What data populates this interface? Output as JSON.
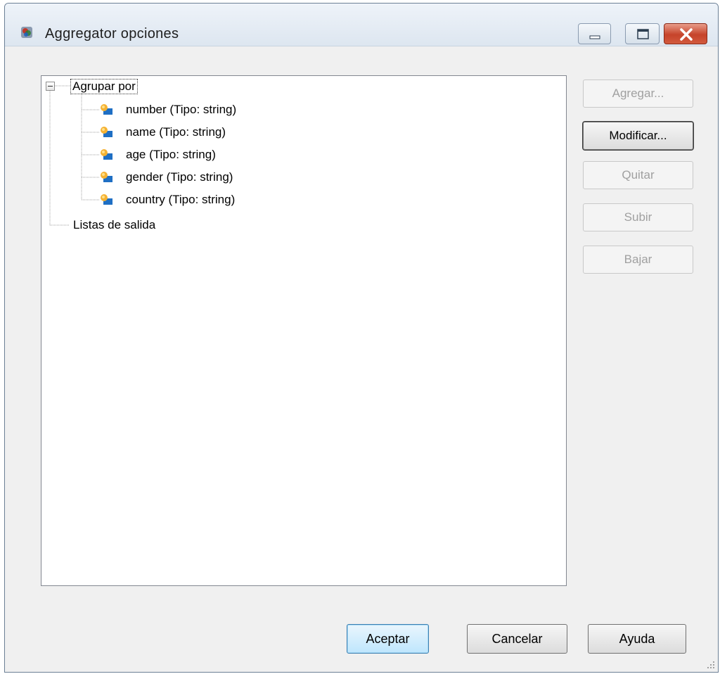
{
  "window": {
    "title": "Aggregator opciones",
    "icon": "app-icon"
  },
  "tree": {
    "root": {
      "label": "Agrupar por",
      "expanded": true,
      "children": [
        {
          "label": "number (Tipo: string)",
          "icon": "field-icon"
        },
        {
          "label": "name (Tipo: string)",
          "icon": "field-icon"
        },
        {
          "label": "age (Tipo: string)",
          "icon": "field-icon"
        },
        {
          "label": "gender (Tipo: string)",
          "icon": "field-icon"
        },
        {
          "label": "country (Tipo: string)",
          "icon": "field-icon"
        }
      ]
    },
    "second": {
      "label": "Listas de salida"
    }
  },
  "side_buttons": {
    "add": "Agregar...",
    "modify": "Modificar...",
    "remove": "Quitar",
    "up": "Subir",
    "down": "Bajar"
  },
  "bottom_buttons": {
    "accept": "Aceptar",
    "cancel": "Cancelar",
    "help": "Ayuda"
  },
  "colors": {
    "window_bg": "#f0f0f0",
    "close_red": "#c6432a",
    "default_button_blue": "#3c7fb1"
  }
}
